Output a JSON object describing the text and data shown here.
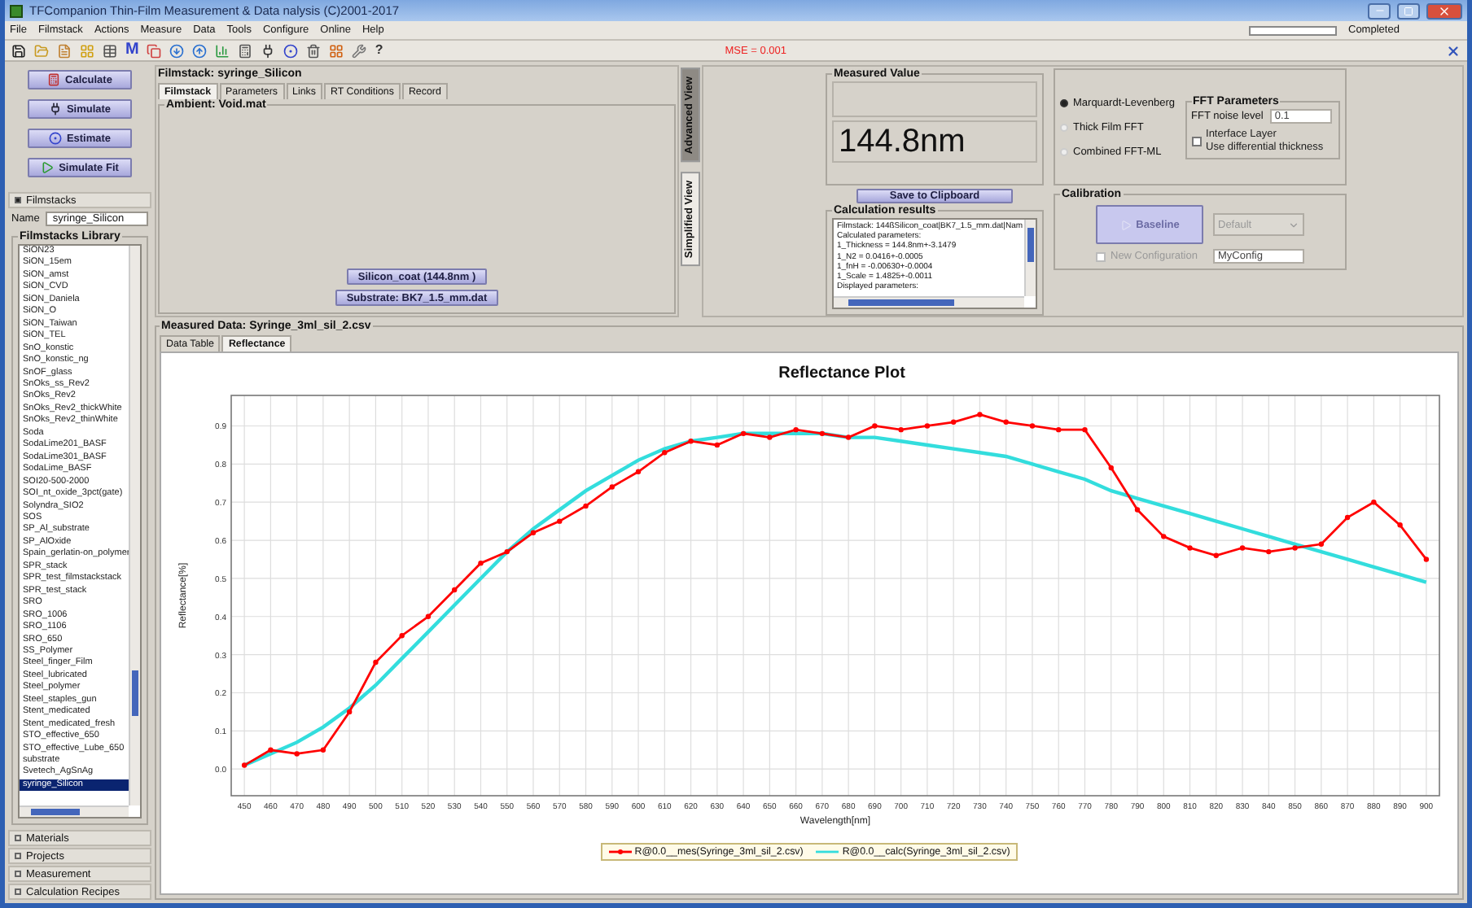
{
  "window": {
    "title": "TFCompanion Thin-Film Measurement & Data nalysis (C)2001-2017"
  },
  "menu": [
    "File",
    "Filmstack",
    "Actions",
    "Measure",
    "Data",
    "Tools",
    "Configure",
    "Online",
    "Help"
  ],
  "status": {
    "progress_label": "Completed",
    "level": 0
  },
  "toolbar": {
    "m_button": "M",
    "help_button": "?",
    "mse": "MSE = 0.001"
  },
  "actions": [
    "Calculate",
    "Simulate",
    "Estimate",
    "Simulate Fit"
  ],
  "sidebar": {
    "sections": [
      {
        "label": "Filmstacks",
        "expanded": true
      },
      {
        "label": "Materials",
        "expanded": false
      },
      {
        "label": "Projects",
        "expanded": false
      },
      {
        "label": "Measurement",
        "expanded": false
      },
      {
        "label": "Calculation Recipes",
        "expanded": false
      }
    ],
    "name_label": "Name",
    "name_value": "syringe_Silicon",
    "library_title": "Filmstacks Library",
    "library": [
      {
        "label": "SiON23",
        "selected": false
      },
      {
        "label": "SiON_15em",
        "selected": false
      },
      {
        "label": "SiON_amst",
        "selected": false
      },
      {
        "label": "SiON_CVD",
        "selected": false
      },
      {
        "label": "SiON_Daniela",
        "selected": false
      },
      {
        "label": "SiON_O",
        "selected": false
      },
      {
        "label": "SiON_Taiwan",
        "selected": false
      },
      {
        "label": "SiON_TEL",
        "selected": false
      },
      {
        "label": "SnO_konstic",
        "selected": false
      },
      {
        "label": "SnO_konstic_ng",
        "selected": false
      },
      {
        "label": "SnOF_glass",
        "selected": false
      },
      {
        "label": "SnOks_ss_Rev2",
        "selected": false
      },
      {
        "label": "SnOks_Rev2",
        "selected": false
      },
      {
        "label": "SnOks_Rev2_thickWhite",
        "selected": false
      },
      {
        "label": "SnOks_Rev2_thinWhite",
        "selected": false
      },
      {
        "label": "Soda",
        "selected": false
      },
      {
        "label": "SodaLime201_BASF",
        "selected": false
      },
      {
        "label": "SodaLime301_BASF",
        "selected": false
      },
      {
        "label": "SodaLime_BASF",
        "selected": false
      },
      {
        "label": "SOI20-500-2000",
        "selected": false
      },
      {
        "label": "SOI_nt_oxide_3pct(gate)",
        "selected": false
      },
      {
        "label": "Solyndra_SIO2",
        "selected": false
      },
      {
        "label": "SOS",
        "selected": false
      },
      {
        "label": "SP_Al_substrate",
        "selected": false
      },
      {
        "label": "SP_AlOxide",
        "selected": false
      },
      {
        "label": "Spain_gerlatin-on_polymer",
        "selected": false
      },
      {
        "label": "SPR_stack",
        "selected": false
      },
      {
        "label": "SPR_test_filmstackstack",
        "selected": false
      },
      {
        "label": "SPR_test_stack",
        "selected": false
      },
      {
        "label": "SRO",
        "selected": false
      },
      {
        "label": "SRO_1006",
        "selected": false
      },
      {
        "label": "SRO_1106",
        "selected": false
      },
      {
        "label": "SRO_650",
        "selected": false
      },
      {
        "label": "SS_Polymer",
        "selected": false
      },
      {
        "label": "Steel_finger_Film",
        "selected": false
      },
      {
        "label": "Steel_lubricated",
        "selected": false
      },
      {
        "label": "Steel_polymer",
        "selected": false
      },
      {
        "label": "Steel_staples_gun",
        "selected": false
      },
      {
        "label": "Stent_medicated",
        "selected": false
      },
      {
        "label": "Stent_medicated_fresh",
        "selected": false
      },
      {
        "label": "STO_effective_650",
        "selected": false
      },
      {
        "label": "STO_effective_Lube_650",
        "selected": false
      },
      {
        "label": "substrate",
        "selected": false
      },
      {
        "label": "Svetech_AgSnAg",
        "selected": false
      },
      {
        "label": "syringe_Silicon",
        "selected": true
      }
    ]
  },
  "filmstack_panel": {
    "title": "Filmstack: syringe_Silicon",
    "tabs": [
      {
        "label": "Filmstack",
        "selected": true
      },
      {
        "label": "Parameters",
        "selected": false
      },
      {
        "label": "Links",
        "selected": false
      },
      {
        "label": "RT Conditions",
        "selected": false
      },
      {
        "label": "Record",
        "selected": false
      }
    ],
    "ambient": "Ambient: Void.mat",
    "layers": [
      "Silicon_coat (144.8nm )",
      "Substrate: BK7_1.5_mm.dat"
    ]
  },
  "view_tabs": [
    {
      "label": "Advanced View",
      "selected": true
    },
    {
      "label": "Simplified View",
      "selected": false
    }
  ],
  "measured_value": {
    "title": "Measured Value",
    "value": "144.8nm"
  },
  "save_button": "Save to Clipboard",
  "calculation_results": {
    "title": "Calculation results",
    "lines": [
      "Filmstack: 144ßSilicon_coat|BK7_1.5_mm.dat|Nam",
      "Calculated parameters:",
      "1_Thickness = 144.8nm+-3.1479",
      "1_N2 = 0.0416+-0.0005",
      "1_fnH = -0.00630+-0.0004",
      "1_Scale = 1.4825+-0.0011",
      "Displayed parameters:"
    ]
  },
  "fit_method": {
    "options": [
      {
        "label": "Marquardt-Levenberg",
        "selected": true
      },
      {
        "label": "Thick Film FFT",
        "selected": false
      },
      {
        "label": "Combined FFT-ML",
        "selected": false
      }
    ]
  },
  "fft_parameters": {
    "title": "FFT Parameters",
    "noise_label": "FFT noise level",
    "noise_value": "0.1",
    "interface_label": "Interface Layer\nUse differential thickness",
    "interface_checked": false
  },
  "calibration": {
    "title": "Calibration",
    "baseline": {
      "label": "Baseline",
      "disabled": true
    },
    "profile": {
      "value": "Default",
      "disabled": true
    },
    "new_configuration": {
      "label": "New Configuration",
      "checked": false,
      "disabled": true
    },
    "config_name": "MyConfig"
  },
  "measured_data": {
    "title": "Measured Data: Syringe_3ml_sil_2.csv",
    "tabs": [
      {
        "label": "Data Table",
        "selected": false
      },
      {
        "label": "Reflectance",
        "selected": true
      }
    ],
    "chart_data": {
      "type": "line",
      "grid": true,
      "title": "Reflectance Plot",
      "xlabel": "Wavelength[nm]",
      "ylabel": "Reflectance[%]",
      "x": [
        450,
        460,
        470,
        480,
        490,
        500,
        510,
        520,
        530,
        540,
        550,
        560,
        570,
        580,
        590,
        600,
        610,
        620,
        630,
        640,
        650,
        660,
        670,
        680,
        690,
        700,
        710,
        720,
        730,
        740,
        750,
        760,
        770,
        780,
        790,
        800,
        810,
        820,
        830,
        840,
        850,
        860,
        870,
        880,
        890,
        900
      ],
      "series": [
        {
          "name": "R@0.0__mes(Syringe_3ml_sil_2.csv)",
          "color": "#ff0000",
          "marker": "circle",
          "values": [
            0.01,
            0.05,
            0.04,
            0.05,
            0.15,
            0.28,
            0.35,
            0.4,
            0.47,
            0.54,
            0.57,
            0.62,
            0.65,
            0.69,
            0.74,
            0.78,
            0.83,
            0.86,
            0.85,
            0.88,
            0.87,
            0.89,
            0.88,
            0.87,
            0.9,
            0.89,
            0.9,
            0.91,
            0.93,
            0.91,
            0.9,
            0.89,
            0.89,
            0.79,
            0.68,
            0.61,
            0.58,
            0.56,
            0.58,
            0.57,
            0.58,
            0.59,
            0.66,
            0.7,
            0.64,
            0.55
          ]
        },
        {
          "name": "R@0.0__calc(Syringe_3ml_sil_2.csv)",
          "color": "#33dddd",
          "values": [
            0.01,
            0.04,
            0.07,
            0.11,
            0.16,
            0.22,
            0.29,
            0.36,
            0.43,
            0.5,
            0.57,
            0.63,
            0.68,
            0.73,
            0.77,
            0.81,
            0.84,
            0.86,
            0.87,
            0.88,
            0.88,
            0.88,
            0.88,
            0.87,
            0.87,
            0.86,
            0.85,
            0.84,
            0.83,
            0.82,
            0.8,
            0.78,
            0.76,
            0.73,
            0.71,
            0.69,
            0.67,
            0.65,
            0.63,
            0.61,
            0.59,
            0.57,
            0.55,
            0.53,
            0.51,
            0.49
          ]
        }
      ],
      "xlim": [
        445,
        905
      ],
      "ylim": [
        -0.07,
        0.98
      ],
      "xticks": [
        450,
        460,
        470,
        480,
        490,
        500,
        510,
        520,
        530,
        540,
        550,
        560,
        570,
        580,
        590,
        600,
        610,
        620,
        630,
        640,
        650,
        660,
        670,
        680,
        690,
        700,
        710,
        720,
        730,
        740,
        750,
        760,
        770,
        780,
        790,
        800,
        810,
        820,
        830,
        840,
        850,
        860,
        870,
        880,
        890,
        900
      ],
      "yticks": [
        {
          "value": 0,
          "label": "0.0"
        },
        {
          "value": 0.1,
          "label": "0.1"
        },
        {
          "value": 0.2,
          "label": "0.2"
        },
        {
          "value": 0.3,
          "label": "0.3"
        },
        {
          "value": 0.4,
          "label": "0.4"
        },
        {
          "value": 0.5,
          "label": "0.5"
        },
        {
          "value": 0.6,
          "label": "0.6"
        },
        {
          "value": 0.7,
          "label": "0.7"
        },
        {
          "value": 0.8,
          "label": "0.8"
        },
        {
          "value": 0.9,
          "label": "0.9"
        }
      ]
    }
  }
}
